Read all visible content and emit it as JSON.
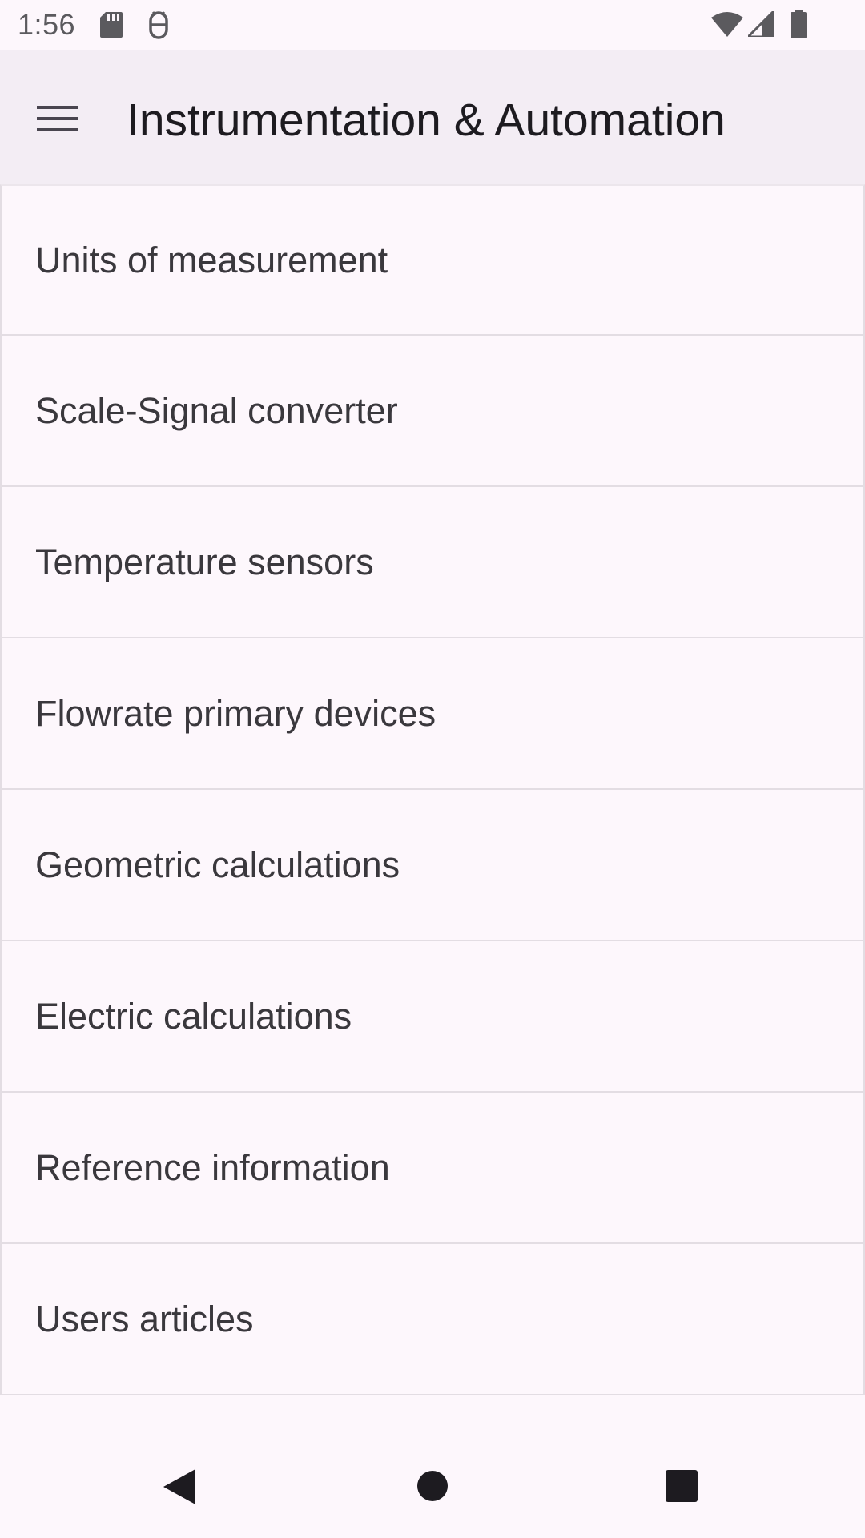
{
  "status_bar": {
    "time": "1:56",
    "icons": [
      "sd-card-icon",
      "debug-icon",
      "wifi-icon",
      "cell-signal-icon",
      "battery-icon"
    ]
  },
  "app_bar": {
    "title": "Instrumentation & Automation",
    "menu_icon": "hamburger-menu-icon"
  },
  "menu": {
    "items": [
      {
        "label": "Units of measurement"
      },
      {
        "label": "Scale-Signal converter"
      },
      {
        "label": "Temperature sensors"
      },
      {
        "label": "Flowrate primary devices"
      },
      {
        "label": "Geometric calculations"
      },
      {
        "label": "Electric calculations"
      },
      {
        "label": "Reference information"
      },
      {
        "label": "Users articles"
      }
    ]
  },
  "nav_bar": {
    "buttons": [
      "back-icon",
      "home-icon",
      "recents-icon"
    ]
  },
  "colors": {
    "background": "#fdf7fc",
    "app_bar": "#f3edf4",
    "divider": "#e3dde3",
    "text": "#3a383d"
  }
}
